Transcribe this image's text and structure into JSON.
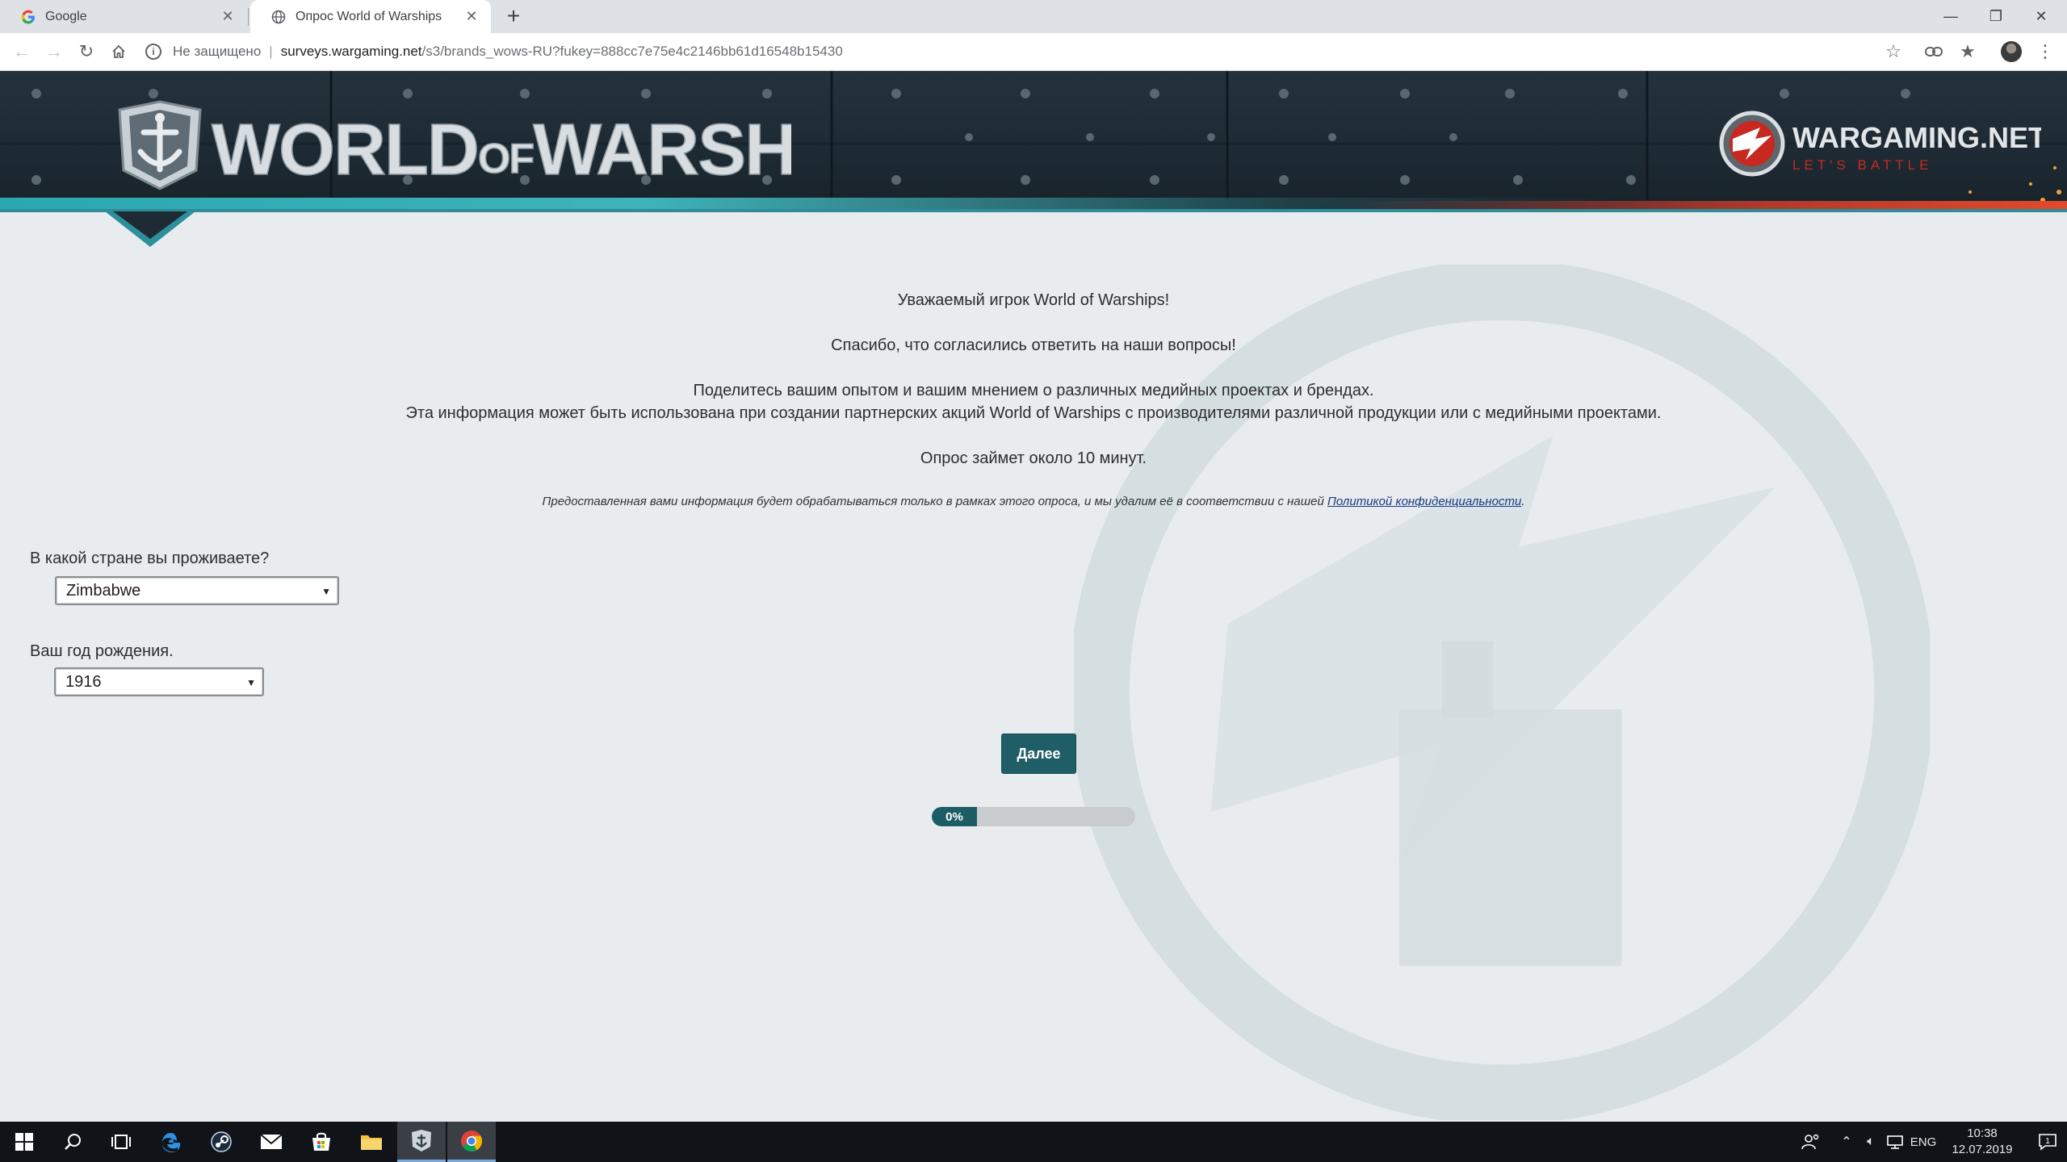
{
  "browser": {
    "tabs": [
      {
        "title": "Google",
        "active": false
      },
      {
        "title": "Опрос World of Warships",
        "active": true
      }
    ],
    "security_label": "Не защищено",
    "url_host": "surveys.wargaming.net",
    "url_path": "/s3/brands_wows-RU?fukey=888cc7e75e4c2146bb61d16548b15430"
  },
  "header": {
    "game_logo_part1": "WORLD",
    "game_logo_part2": "OF",
    "game_logo_part3": "WARSHIPS",
    "publisher_name": "WARGAMING.NET",
    "publisher_tagline": "LET'S BATTLE"
  },
  "intro": {
    "greeting": "Уважаемый игрок World of Warships!",
    "thanks": "Спасибо, что согласились ответить на наши вопросы!",
    "line1": "Поделитесь вашим опытом и вашим мнением о различных медийных проектах и брендах.",
    "line2": "Эта информация может быть использована при создании партнерских акций World of Warships с производителями различной продукции или с медийными проектами.",
    "duration": "Опрос займет около 10 минут."
  },
  "privacy": {
    "text": "Предоставленная вами информация будет обрабатываться только в рамках этого опроса, и мы удалим её в соответствии с нашей ",
    "link": "Политикой конфиденциальности",
    "end": "."
  },
  "questions": [
    {
      "label": "В какой стране вы проживаете?",
      "selected": "Zimbabwe"
    },
    {
      "label": "Ваш год рождения.",
      "selected": "1916"
    }
  ],
  "next_button": "Далее",
  "progress": {
    "label": "0%",
    "value": 0
  },
  "taskbar": {
    "language": "ENG",
    "time": "10:38",
    "date": "12.07.2019",
    "notification_count": "1"
  },
  "colors": {
    "accent_teal": "#1f5e66",
    "header_dark": "#1e2a33",
    "page_bg": "#e8ecee"
  }
}
